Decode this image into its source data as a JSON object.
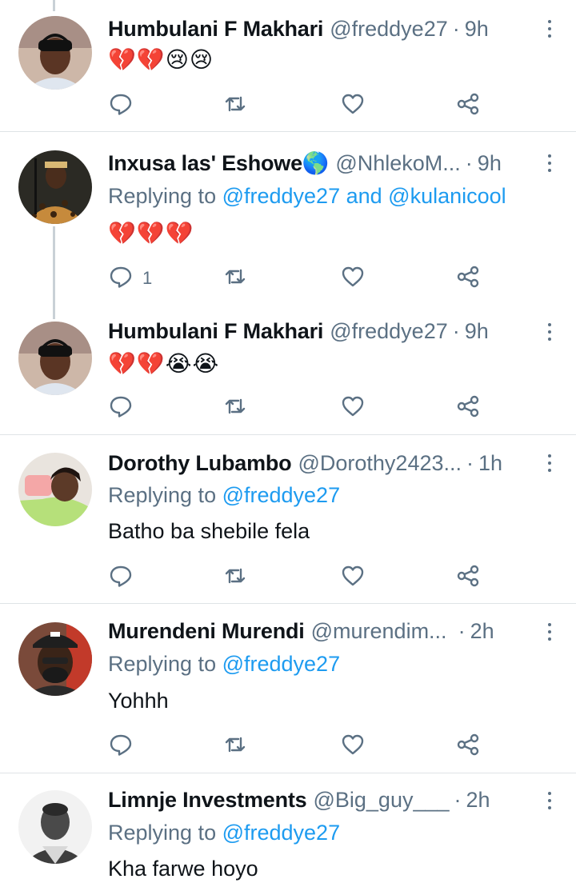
{
  "tweets": [
    {
      "name": "Humbulani F Makhari",
      "handle": "@freddye27",
      "separator": "·",
      "time": "9h",
      "replying_prefix": "",
      "mentions": [],
      "text": "",
      "emoji": "💔💔😢😢",
      "reply_count": ""
    },
    {
      "name": "Inxusa las' Eshowe🌎",
      "handle": "@NhlekoM...",
      "separator": "·",
      "time": "9h",
      "replying_prefix": "Replying to ",
      "mention_1": "@freddye27",
      "joiner": " and ",
      "mention_2": "@kulanicool",
      "text": "",
      "emoji": "💔💔💔",
      "reply_count": "1"
    },
    {
      "name": "Humbulani F Makhari",
      "handle": "@freddye27",
      "separator": "·",
      "time": "9h",
      "text": "",
      "emoji": "💔💔😭😭",
      "reply_count": ""
    },
    {
      "name": "Dorothy Lubambo",
      "handle": "@Dorothy2423...",
      "separator": "·",
      "time": "1h",
      "replying_prefix": "Replying to ",
      "mention_1": "@freddye27",
      "text": "Batho ba shebile fela",
      "reply_count": ""
    },
    {
      "name": "Murendeni Murendi",
      "handle": "@murendim...",
      "separator": "·",
      "time": "2h",
      "replying_prefix": "Replying to ",
      "mention_1": "@freddye27",
      "text": "Yohhh",
      "reply_count": ""
    },
    {
      "name": "Limnje Investments",
      "handle": "@Big_guy___",
      "separator": "·",
      "time": "2h",
      "replying_prefix": "Replying to ",
      "mention_1": "@freddye27",
      "text": "Kha farwe hoyo",
      "reply_count": ""
    }
  ],
  "icons": {
    "reply": "reply-icon",
    "retweet": "retweet-icon",
    "like": "heart-icon",
    "share": "share-icon",
    "more": "more-vertical-icon"
  },
  "colors": {
    "link": "#1d9bf0",
    "secondary_text": "#5b7083",
    "icon": "#5b7083",
    "thread_line": "#c9d1d6",
    "divider": "#dfe3e6"
  }
}
